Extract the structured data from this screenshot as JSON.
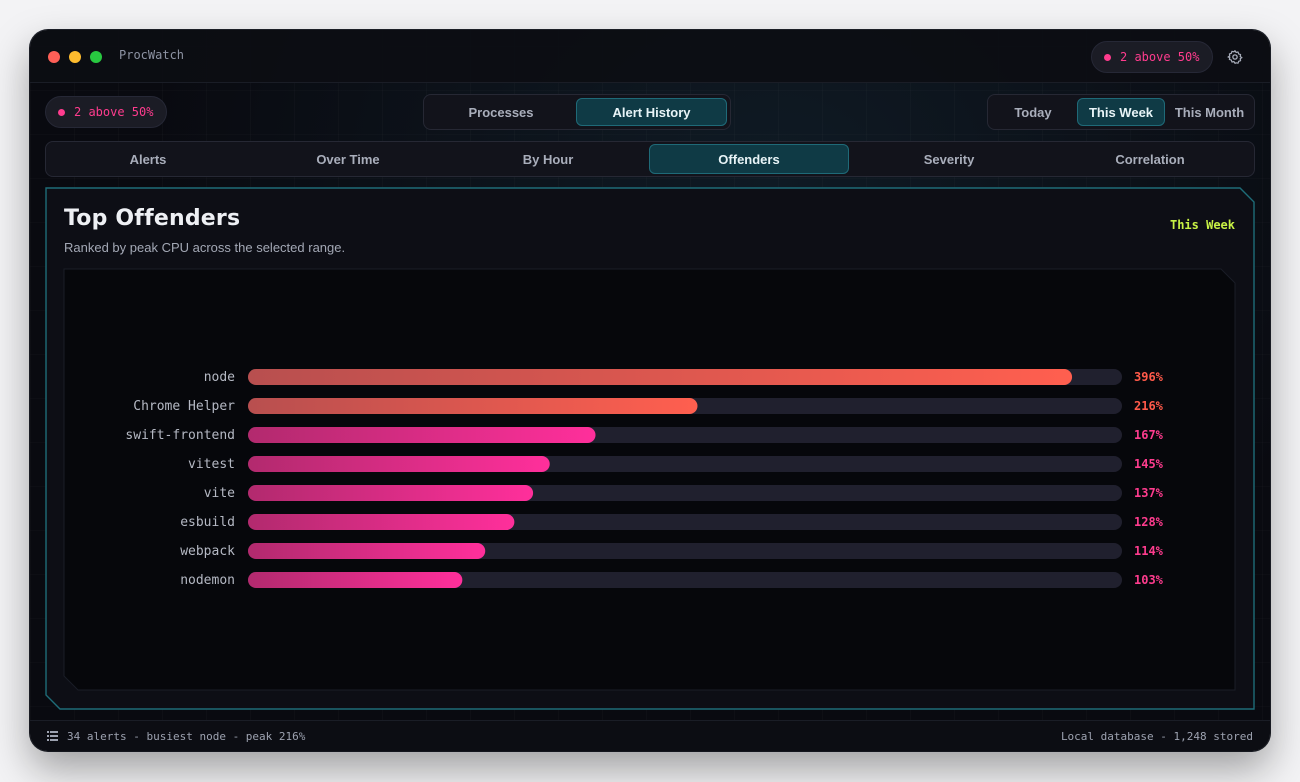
{
  "app": {
    "title": "ProcWatch"
  },
  "titlebar": {
    "alert_pill": "2 above 50%"
  },
  "toolbar": {
    "alert_pill": "2 above 50%",
    "view_tabs": [
      {
        "label": "Processes",
        "active": false
      },
      {
        "label": "Alert History",
        "active": true
      }
    ],
    "range_tabs": [
      {
        "label": "Today",
        "active": false
      },
      {
        "label": "This Week",
        "active": true
      },
      {
        "label": "This Month",
        "active": false
      }
    ]
  },
  "subtabs": [
    {
      "label": "Alerts",
      "active": false
    },
    {
      "label": "Over Time",
      "active": false
    },
    {
      "label": "By Hour",
      "active": false
    },
    {
      "label": "Offenders",
      "active": true
    },
    {
      "label": "Severity",
      "active": false
    },
    {
      "label": "Correlation",
      "active": false
    }
  ],
  "panel": {
    "title": "Top Offenders",
    "subtitle": "Ranked by peak CPU across the selected range.",
    "range_label": "This Week"
  },
  "chart_data": {
    "type": "bar",
    "orientation": "horizontal",
    "categories": [
      "node",
      "Chrome Helper",
      "swift-frontend",
      "vitest",
      "vite",
      "esbuild",
      "webpack",
      "nodemon"
    ],
    "values": [
      396,
      216,
      167,
      145,
      137,
      128,
      114,
      103
    ],
    "value_labels": [
      "396%",
      "216%",
      "167%",
      "145%",
      "137%",
      "128%",
      "114%",
      "103%"
    ],
    "xlim": [
      0,
      420
    ],
    "grid": false,
    "colors": {
      "top": [
        "#b84f4f",
        "#ff5f4f"
      ],
      "rest": [
        "#b22a6e",
        "#ff2f9b"
      ],
      "track": "#20202e",
      "label_top": "#ff5a4a",
      "label_rest": "#ff3c8e"
    },
    "highlight_top_n": 2
  },
  "statusbar": {
    "left": "34 alerts - busiest node - peak 216%",
    "right": "Local database - 1,248 stored"
  },
  "colors": {
    "accent": "#1f6a78",
    "alert": "#ff3c8e",
    "range_label": "#c8f245"
  }
}
